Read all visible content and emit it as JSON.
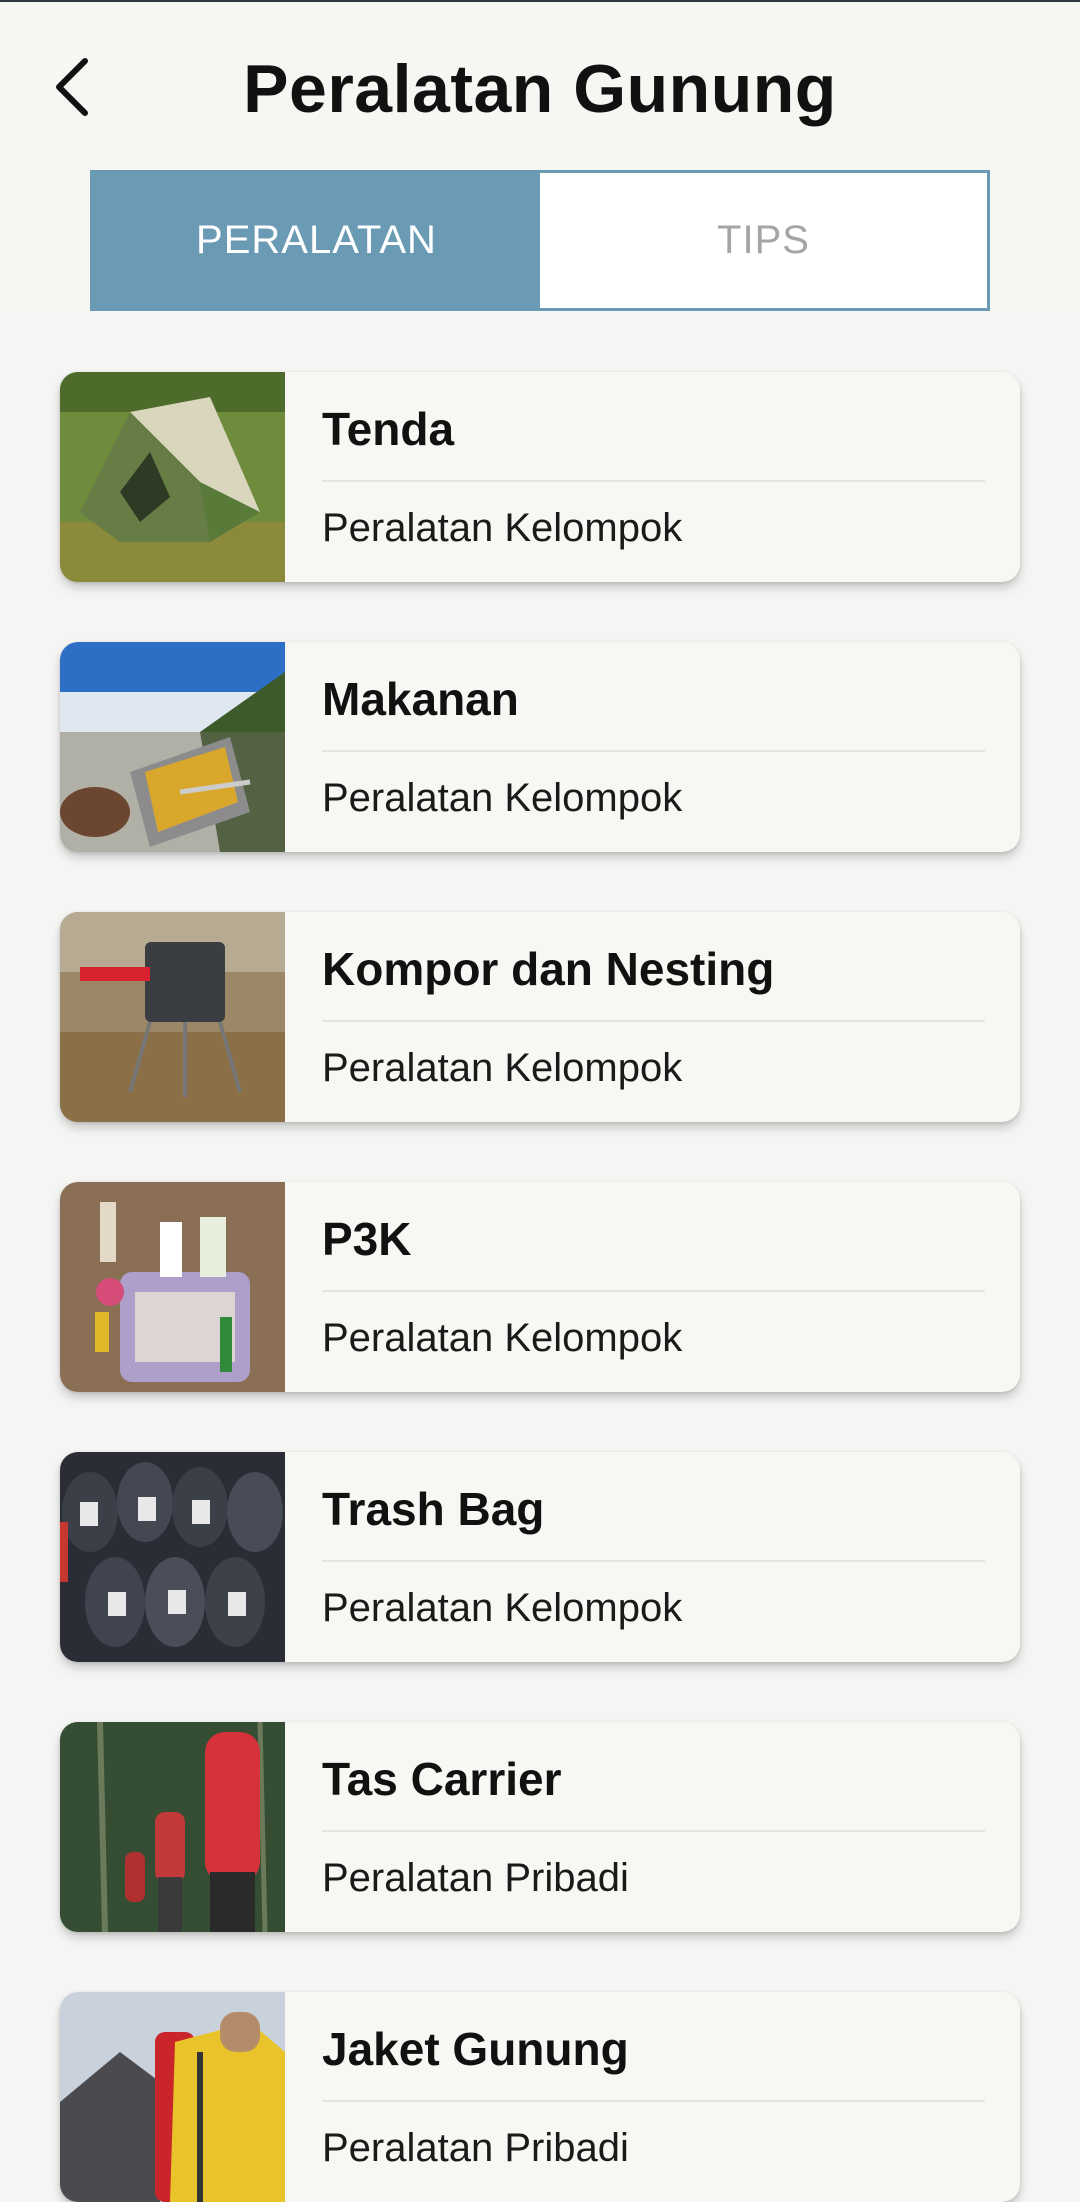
{
  "header": {
    "title": "Peralatan Gunung",
    "back_icon": "back-arrow-icon"
  },
  "tabs": [
    {
      "label": "PERALATAN",
      "active": true
    },
    {
      "label": "TIPS",
      "active": false
    }
  ],
  "colors": {
    "accent": "#6a9ab4",
    "background": "#f5f5f4",
    "card": "#f7f7f4"
  },
  "items": [
    {
      "title": "Tenda",
      "subtitle": "Peralatan Kelompok",
      "image": "tent-photo"
    },
    {
      "title": "Makanan",
      "subtitle": "Peralatan Kelompok",
      "image": "food-pan-photo"
    },
    {
      "title": "Kompor dan Nesting",
      "subtitle": "Peralatan Kelompok",
      "image": "stove-photo"
    },
    {
      "title": "P3K",
      "subtitle": "Peralatan Kelompok",
      "image": "first-aid-photo"
    },
    {
      "title": "Trash Bag",
      "subtitle": "Peralatan Kelompok",
      "image": "trash-bags-photo"
    },
    {
      "title": "Tas Carrier",
      "subtitle": "Peralatan Pribadi",
      "image": "carrier-backpack-photo"
    },
    {
      "title": "Jaket Gunung",
      "subtitle": "Peralatan Pribadi",
      "image": "mountain-jacket-photo"
    }
  ]
}
